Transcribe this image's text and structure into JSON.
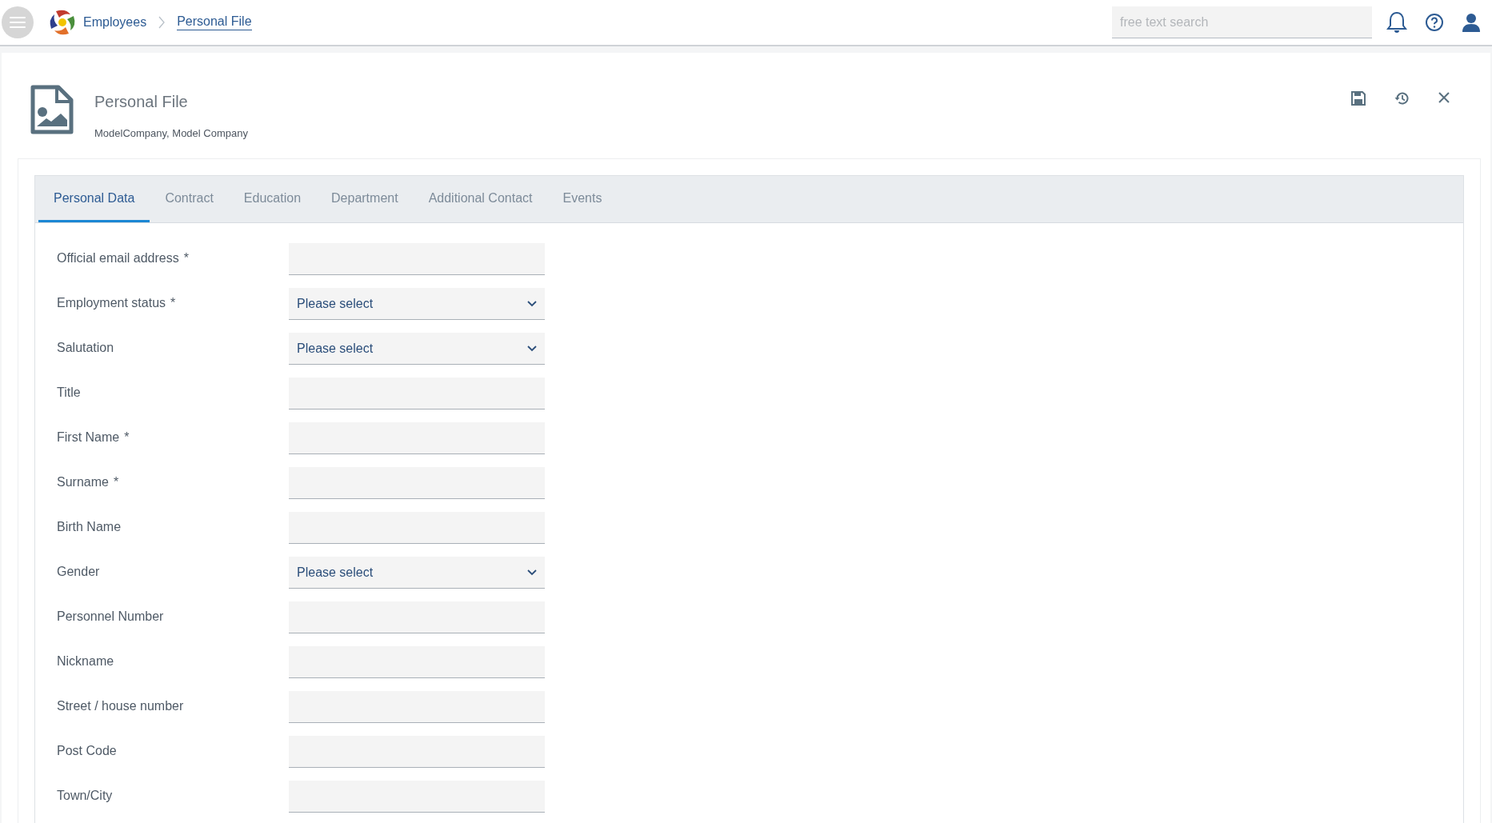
{
  "topbar": {
    "breadcrumbs": [
      {
        "label": "Employees",
        "selected": false
      },
      {
        "label": "Personal File",
        "selected": true
      }
    ],
    "search": {
      "placeholder": "free text search"
    }
  },
  "header": {
    "title": "Personal File",
    "subtitle": "ModelCompany, Model Company"
  },
  "tabs": [
    {
      "label": "Personal Data",
      "selected": true
    },
    {
      "label": "Contract",
      "selected": false
    },
    {
      "label": "Education",
      "selected": false
    },
    {
      "label": "Department",
      "selected": false
    },
    {
      "label": "Additional Contact",
      "selected": false
    },
    {
      "label": "Events",
      "selected": false
    }
  ],
  "fields": [
    {
      "label": "Official email address",
      "marker": "*",
      "kind": "text"
    },
    {
      "label": "Employment status",
      "marker": "*",
      "kind": "select",
      "value": "Please select"
    },
    {
      "label": "Salutation",
      "kind": "select",
      "value": "Please select"
    },
    {
      "label": "Title",
      "kind": "text"
    },
    {
      "label": "First Name",
      "marker": "*",
      "kind": "text"
    },
    {
      "label": "Surname",
      "marker": "*",
      "kind": "text"
    },
    {
      "label": "Birth Name",
      "kind": "text"
    },
    {
      "label": "Gender",
      "kind": "select",
      "value": "Please select"
    },
    {
      "label": "Personnel Number",
      "kind": "text"
    },
    {
      "label": "Nickname",
      "kind": "text"
    },
    {
      "label": "Street / house number",
      "kind": "text"
    },
    {
      "label": "Post Code",
      "kind": "text"
    },
    {
      "label": "Town/City",
      "kind": "text"
    }
  ]
}
